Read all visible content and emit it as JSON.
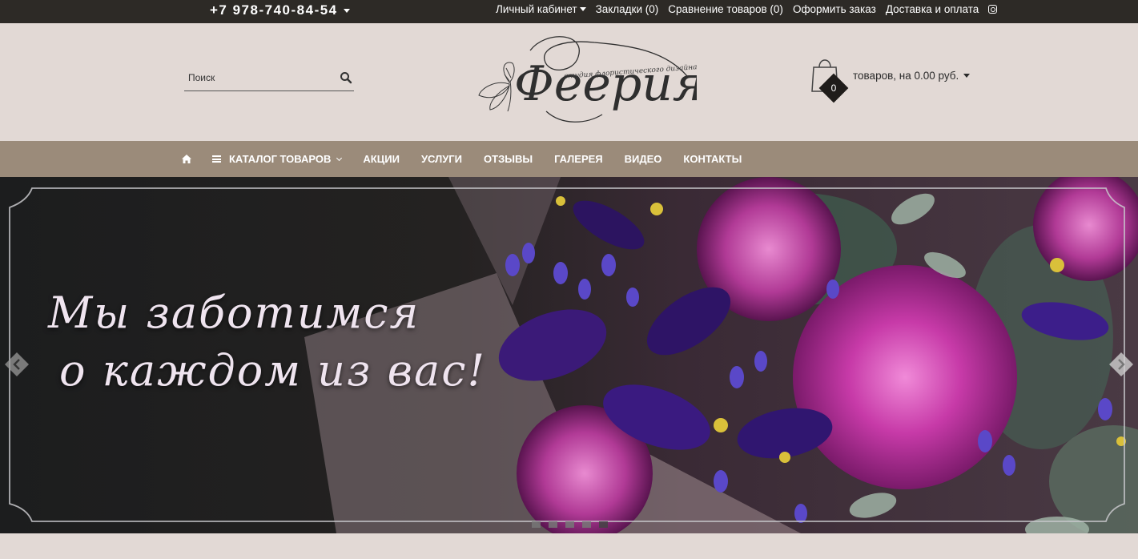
{
  "topbar": {
    "phone": "+7 978-740-84-54",
    "links": [
      "Личный кабинет",
      "Закладки (0)",
      "Сравнение товаров (0)",
      "Оформить заказ",
      "Доставка и оплата"
    ],
    "instagram_icon": "instagram-icon"
  },
  "header": {
    "search_placeholder": "Поиск",
    "search_icon": "search-icon",
    "logo_title": "Феерия",
    "logo_subtitle": "студия флористического дизайна",
    "cart_count": "0",
    "cart_text": "товаров, на 0.00 руб.",
    "cart_icon": "shopping-bag-icon"
  },
  "nav": {
    "home_icon": "home-icon",
    "items": [
      "КАТАЛОГ ТОВАРОВ",
      "АКЦИИ",
      "УСЛУГИ",
      "ОТЗЫВЫ",
      "ГАЛЕРЕЯ",
      "ВИДЕО",
      "КОНТАКТЫ"
    ]
  },
  "slider": {
    "line1": "Мы заботимся",
    "line2": "о каждом из вас!",
    "slide_count": 5,
    "active_slide": 5
  },
  "colors": {
    "topbar_bg": "#2d2a26",
    "header_bg": "#e2d9d5",
    "nav_bg": "#9b8b7a",
    "accent_dark": "#1f1c1a"
  }
}
